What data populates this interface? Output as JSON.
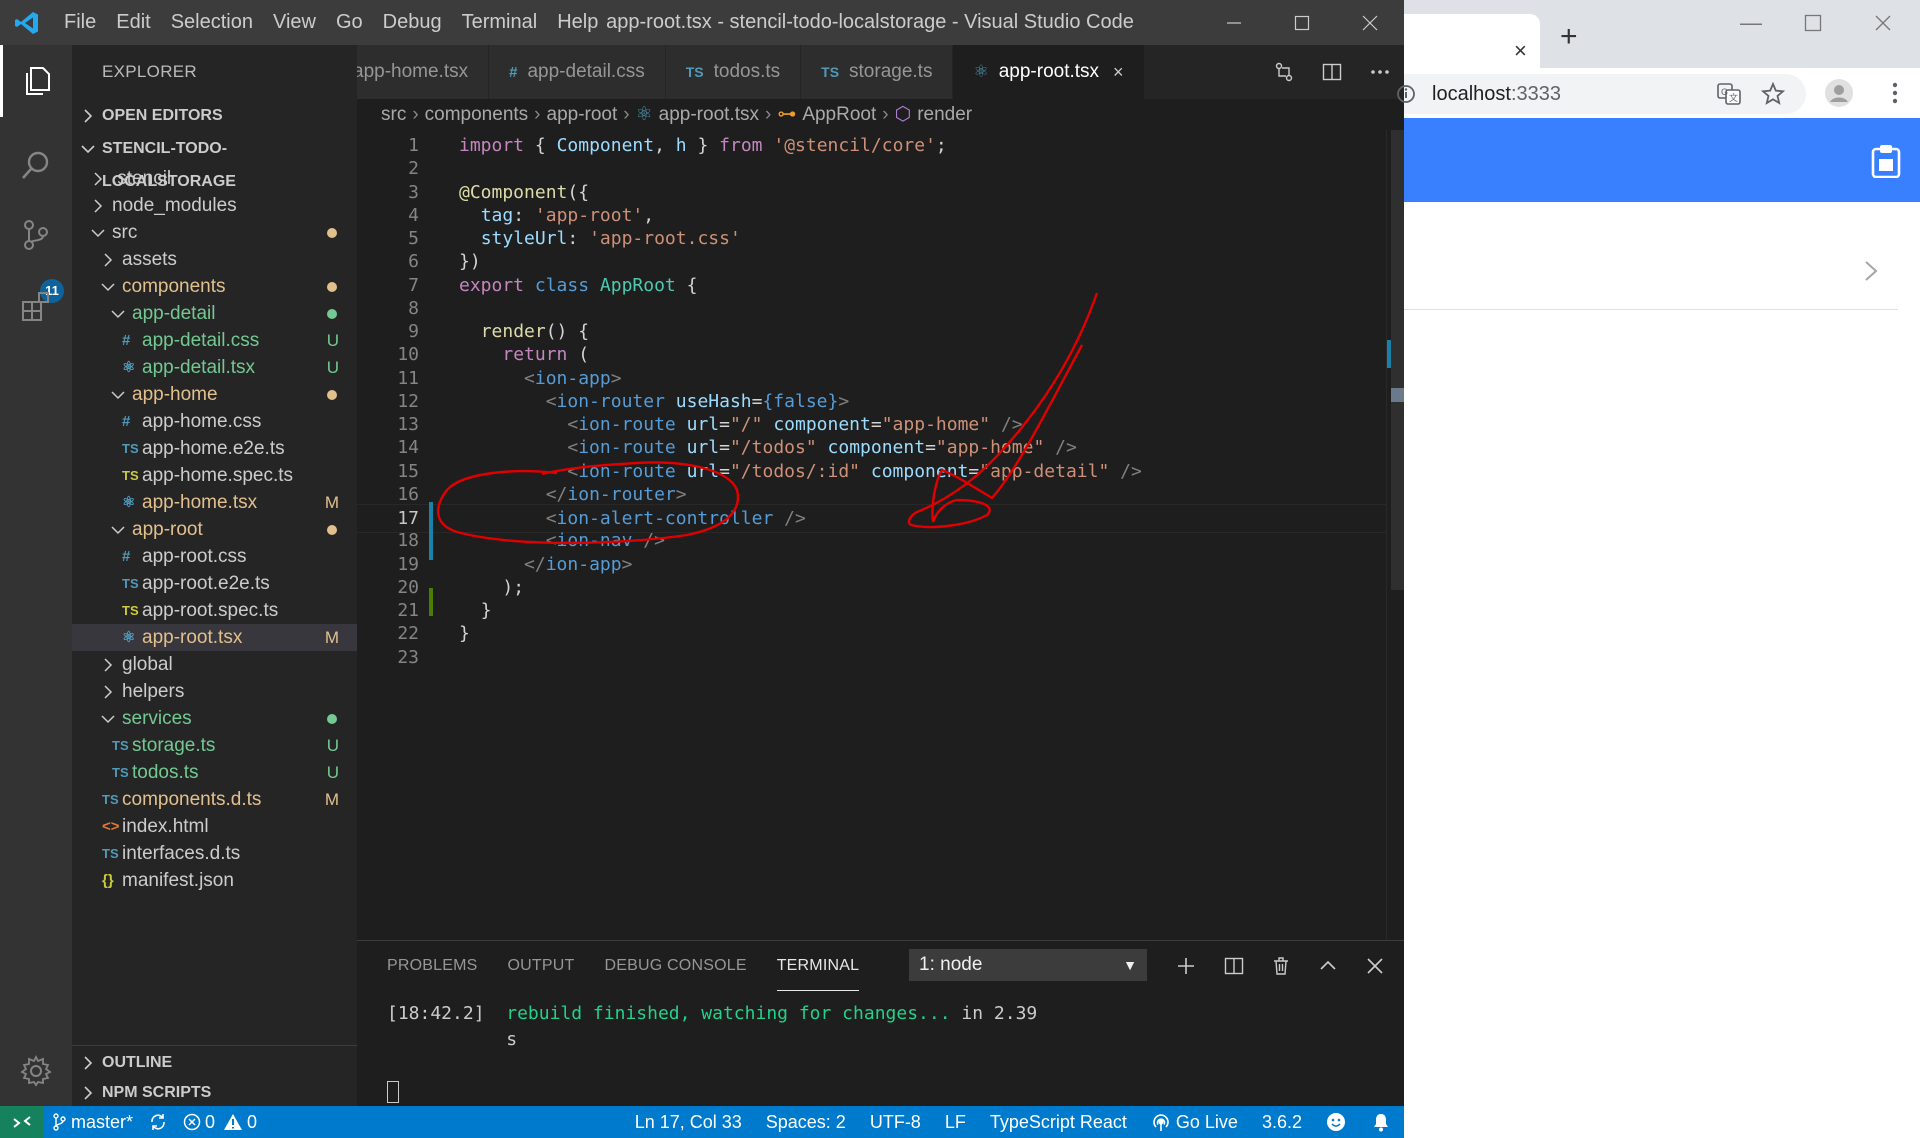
{
  "vscode": {
    "menu": [
      "File",
      "Edit",
      "Selection",
      "View",
      "Go",
      "Debug",
      "Terminal",
      "Help"
    ],
    "window_title": "app-root.tsx - stencil-todo-localstorage - Visual Studio Code",
    "activity_badge": "11",
    "explorer": {
      "title": "EXPLORER",
      "open_editors": "OPEN EDITORS",
      "project": "STENCIL-TODO-LOCALSTORAGE",
      "outline": "OUTLINE",
      "npm_scripts": "NPM SCRIPTS",
      "tree": [
        {
          "name": ".stencil",
          "icon": "",
          "badge": ""
        },
        {
          "name": "node_modules",
          "icon": "",
          "badge": ""
        },
        {
          "name": "src",
          "icon": "",
          "badge": ""
        },
        {
          "name": "assets",
          "icon": "",
          "badge": ""
        },
        {
          "name": "components",
          "icon": "",
          "badge": ""
        },
        {
          "name": "app-detail",
          "icon": "",
          "badge": ""
        },
        {
          "name": "app-detail.css",
          "icon": "#",
          "badge": "U"
        },
        {
          "name": "app-detail.tsx",
          "icon": "⚛",
          "badge": "U"
        },
        {
          "name": "app-home",
          "icon": "",
          "badge": ""
        },
        {
          "name": "app-home.css",
          "icon": "#",
          "badge": ""
        },
        {
          "name": "app-home.e2e.ts",
          "icon": "TS",
          "badge": ""
        },
        {
          "name": "app-home.spec.ts",
          "icon": "TS",
          "badge": ""
        },
        {
          "name": "app-home.tsx",
          "icon": "⚛",
          "badge": "M"
        },
        {
          "name": "app-root",
          "icon": "",
          "badge": ""
        },
        {
          "name": "app-root.css",
          "icon": "#",
          "badge": ""
        },
        {
          "name": "app-root.e2e.ts",
          "icon": "TS",
          "badge": ""
        },
        {
          "name": "app-root.spec.ts",
          "icon": "TS",
          "badge": ""
        },
        {
          "name": "app-root.tsx",
          "icon": "⚛",
          "badge": "M"
        },
        {
          "name": "global",
          "icon": "",
          "badge": ""
        },
        {
          "name": "helpers",
          "icon": "",
          "badge": ""
        },
        {
          "name": "services",
          "icon": "",
          "badge": ""
        },
        {
          "name": "storage.ts",
          "icon": "TS",
          "badge": "U"
        },
        {
          "name": "todos.ts",
          "icon": "TS",
          "badge": "U"
        },
        {
          "name": "components.d.ts",
          "icon": "TS",
          "badge": "M"
        },
        {
          "name": "index.html",
          "icon": "<>",
          "badge": ""
        },
        {
          "name": "interfaces.d.ts",
          "icon": "TS",
          "badge": ""
        },
        {
          "name": "manifest.json",
          "icon": "{}",
          "badge": ""
        }
      ]
    },
    "tabs": [
      {
        "label": "app-home.tsx",
        "icon": ""
      },
      {
        "label": "app-detail.css",
        "icon": "#"
      },
      {
        "label": "todos.ts",
        "icon": "TS"
      },
      {
        "label": "storage.ts",
        "icon": "TS"
      },
      {
        "label": "app-root.tsx",
        "icon": "⚛",
        "close": "×"
      }
    ],
    "breadcrumb": [
      "src",
      "components",
      "app-root",
      "app-root.tsx",
      "AppRoot",
      "render"
    ],
    "line_numbers": [
      "1",
      "2",
      "3",
      "4",
      "5",
      "6",
      "7",
      "8",
      "9",
      "10",
      "11",
      "12",
      "13",
      "14",
      "15",
      "16",
      "17",
      "18",
      "19",
      "20",
      "21",
      "22",
      "23"
    ],
    "panel": {
      "tabs": [
        "PROBLEMS",
        "OUTPUT",
        "DEBUG CONSOLE",
        "TERMINAL"
      ],
      "terminal_select": "1: node",
      "terminal_time": "[18:42.2]",
      "terminal_msg": "rebuild finished, watching for changes...",
      "terminal_tail": " in 2.39",
      "terminal_wrap": "s"
    },
    "status": {
      "branch": "master*",
      "errors": "0",
      "warnings": "0",
      "position": "Ln 17, Col 33",
      "spaces": "Spaces: 2",
      "encoding": "UTF-8",
      "eol": "LF",
      "language": "TypeScript React",
      "golive": "Go Live",
      "ts_version": "3.6.2"
    }
  },
  "browser": {
    "tab_close": "×",
    "new_tab": "+",
    "url_host": "localhost",
    "url_port": ":3333",
    "header_color": "#3880ff"
  },
  "colors": {
    "vscode_accent": "#007acc",
    "annotation": "#e00000",
    "modified": "#e2c08d",
    "untracked": "#73c991"
  }
}
